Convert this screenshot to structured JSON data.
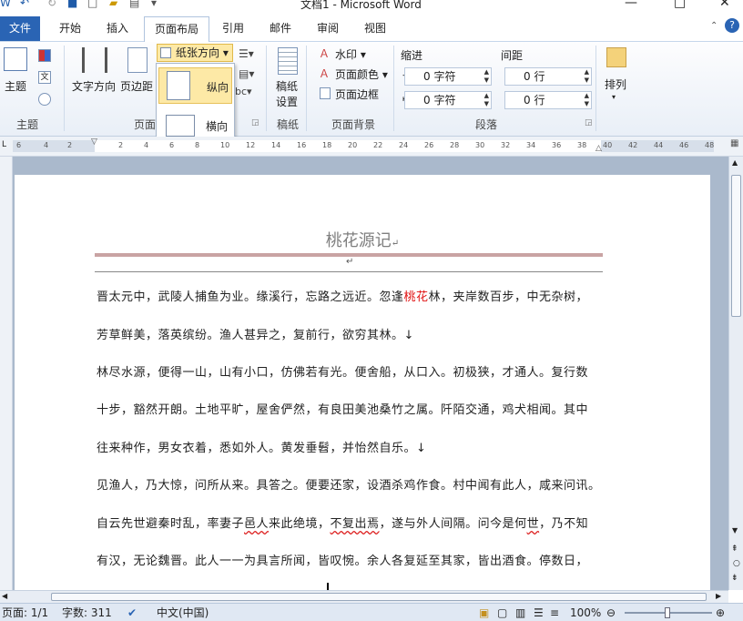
{
  "window": {
    "title": "文档1 - Microsoft Word"
  },
  "tabs": {
    "file": "文件",
    "home": "开始",
    "insert": "插入",
    "layout": "页面布局",
    "references": "引用",
    "mailings": "邮件",
    "review": "审阅",
    "view": "视图"
  },
  "ribbon": {
    "themes": {
      "themes_label": "主题",
      "group_label": "主题"
    },
    "page_setup": {
      "text_direction": "文字方向",
      "margins": "页边距",
      "orientation": "纸张方向",
      "group_label": "页面设置"
    },
    "draft_paper": {
      "label": "稿纸\n设置",
      "label1": "稿纸",
      "label2": "设置",
      "group_label": "稿纸"
    },
    "page_background": {
      "watermark": "水印",
      "page_color": "页面颜色",
      "page_borders": "页面边框",
      "group_label": "页面背景"
    },
    "paragraph": {
      "indent_label": "缩进",
      "spacing_label": "间距",
      "indent_left": "0 字符",
      "indent_right": "0 字符",
      "spacing_before": "0 行",
      "spacing_after": "0 行",
      "group_label": "段落"
    },
    "arrange": {
      "label": "排列"
    }
  },
  "orientation_menu": {
    "portrait": "纵向",
    "landscape": "横向",
    "highlighted": "portrait"
  },
  "ruler_ticks": [
    "6",
    "4",
    "2",
    "2",
    "4",
    "6",
    "8",
    "10",
    "12",
    "14",
    "16",
    "18",
    "20",
    "22",
    "24",
    "26",
    "28",
    "30",
    "32",
    "34",
    "36",
    "38",
    "40",
    "42",
    "44",
    "46",
    "48"
  ],
  "document": {
    "title": "桃花源记",
    "lines": [
      {
        "pre": "晋太元中，武陵人捕鱼为业。缘溪行，忘路之远近。忽逢",
        "red": "桃花",
        "post": "林，夹岸数百步，中无杂树，"
      },
      {
        "text": "芳草鲜美，落英缤纷。渔人甚异之，复前行，欲穷其林。↓"
      },
      {
        "text": "林尽水源，便得一山，山有小口，仿佛若有光。便舍船，从口入。初极狭，才通人。复行数"
      },
      {
        "text": "十步，豁然开朗。土地平旷，屋舍俨然，有良田美池桑竹之属。阡陌交通，鸡犬相闻。其中"
      },
      {
        "text": "往来种作，男女衣着，悉如外人。黄发垂髫，并怡然自乐。↓"
      },
      {
        "text": "见渔人，乃大惊，问所从来。具答之。便要还家，设酒杀鸡作食。村中闻有此人，咸来问讯。"
      },
      {
        "pre": "自云先世避秦时乱，率妻子",
        "w1": "邑人",
        "mid": "来此绝境，",
        "w2": "不复出焉",
        "mid2": "，遂与外人间隔。问今是何",
        "w3": "世",
        "post": "，乃不知"
      },
      {
        "text": "有汉，无论魏晋。此人一一为具言所闻，皆叹惋。余人各复延至其家，皆出酒食。停数日，"
      }
    ]
  },
  "status": {
    "page": "页面: 1/1",
    "words": "字数: 311",
    "language": "中文(中国)",
    "zoom": "100%"
  },
  "colors": {
    "accent": "#2a64b4",
    "highlight": "#fde9a6",
    "red_text": "#e01010"
  }
}
